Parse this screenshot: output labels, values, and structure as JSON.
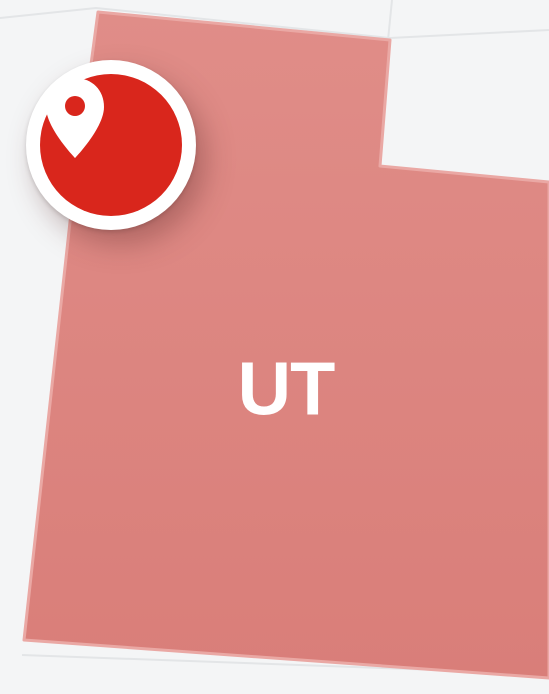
{
  "map": {
    "state": {
      "abbreviation": "UT",
      "fill_color": "#dc807b",
      "border_color": "#e9a7a3"
    },
    "background_color": "#f4f5f6",
    "marker": {
      "icon": "location-pin-icon",
      "color": "#d9261c",
      "ring_color": "#ffffff"
    }
  }
}
